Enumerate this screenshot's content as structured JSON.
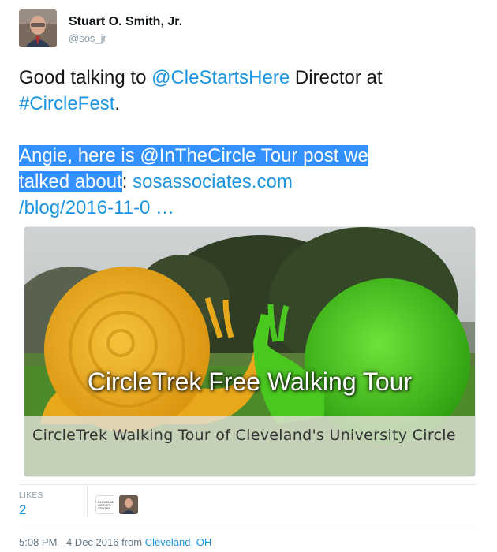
{
  "author": {
    "name": "Stuart O. Smith, Jr.",
    "handle": "@sos_jr"
  },
  "tweet": {
    "line1_pre": "Good talking to ",
    "line1_mention": "@CleStartsHere",
    "line1_post": " Director at",
    "hashtag": "#CircleFest",
    "hashtag_post": ".",
    "hl_line1": "Angie, here is @InTheCircle Tour post we",
    "hl_line2": "talked about",
    "after_hl": ": ",
    "link_part1": "sosassociates.com",
    "link_part2": "/blog/2016-11-0",
    "link_ellipsis": " …"
  },
  "card": {
    "image_overlay_text": "CircleTrek Free Walking Tour",
    "caption": "CircleTrek Walking Tour of Cleveland's University Circle"
  },
  "stats": {
    "likes_label": "LIKES",
    "likes_count": "2",
    "liker_logo_text": "CLEVELAND HISTORY CENTER"
  },
  "footer": {
    "time": "5:08 PM - 4 Dec 2016 from ",
    "location": "Cleveland, OH"
  },
  "colors": {
    "link": "#1b95e0",
    "selection": "#3390ff",
    "muted": "#8899a6"
  }
}
